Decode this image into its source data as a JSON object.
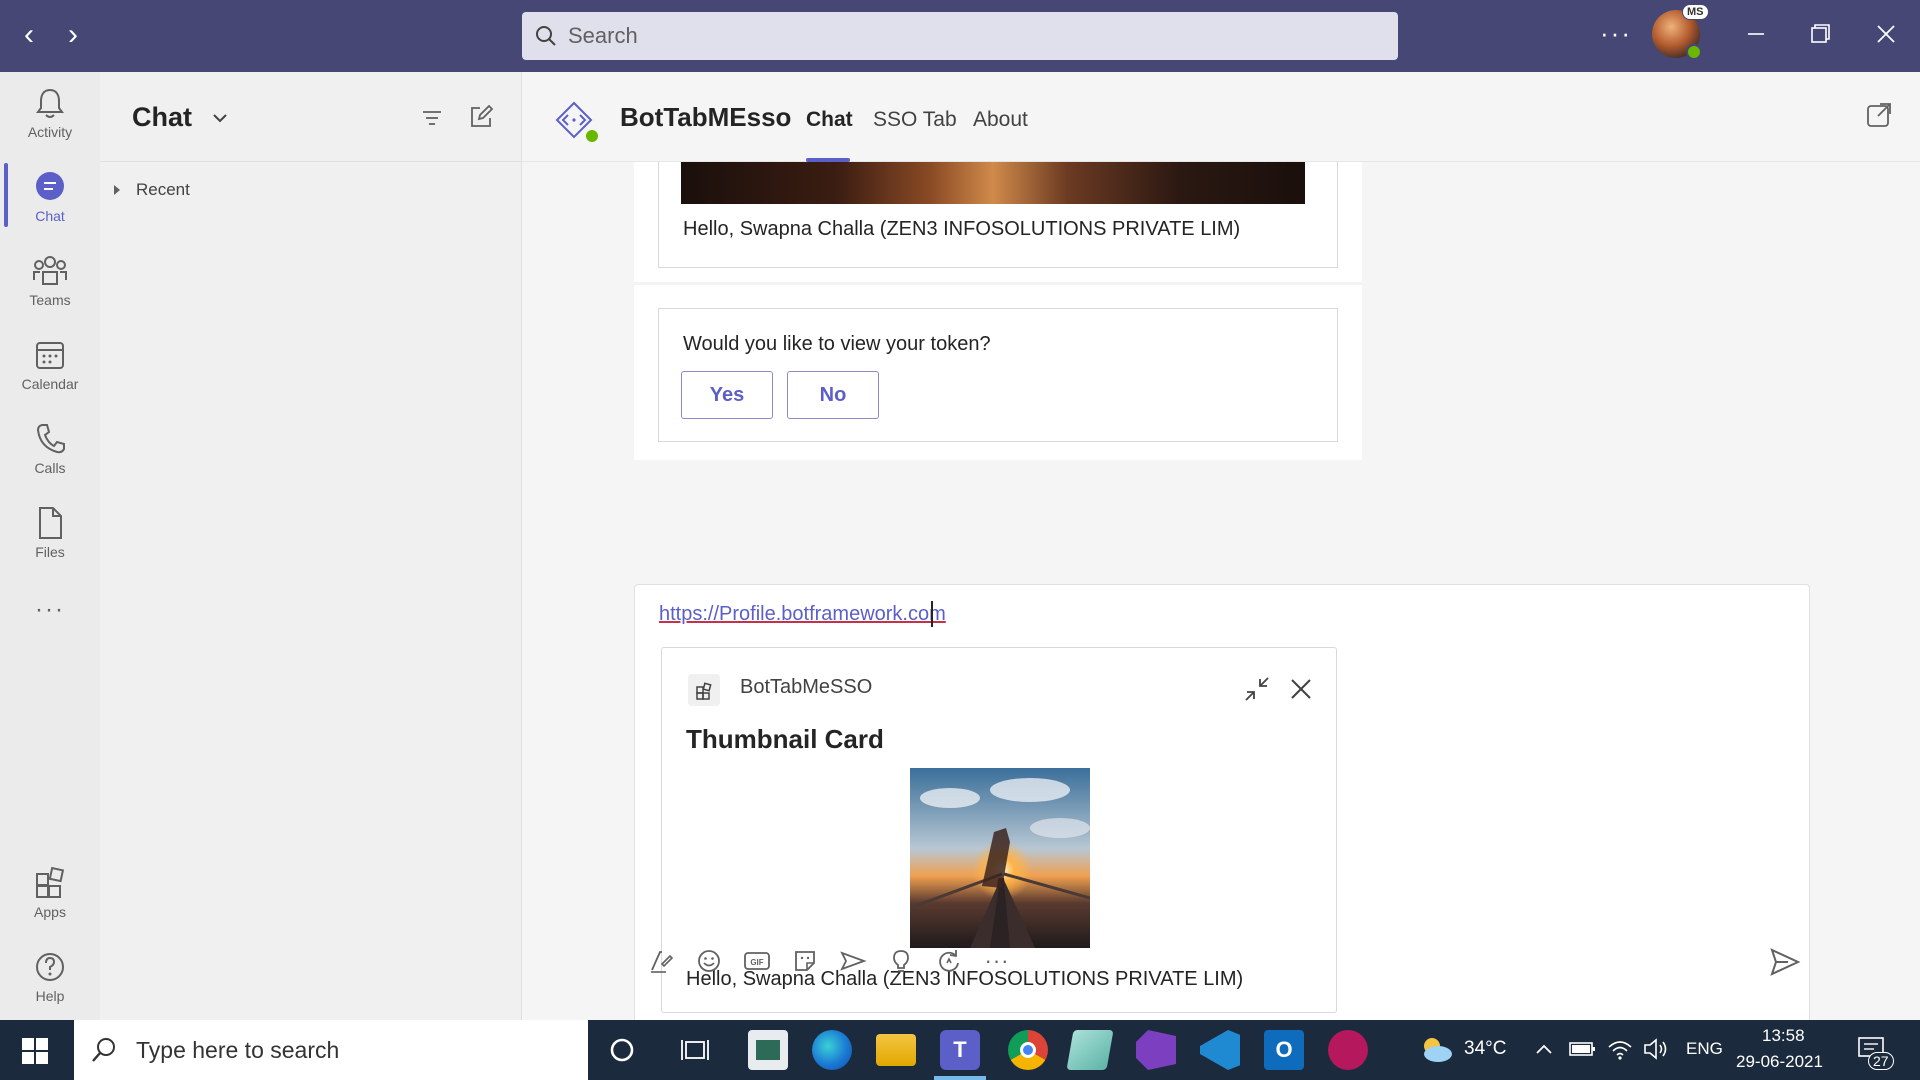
{
  "titlebar": {
    "search_placeholder": "Search",
    "more": "···",
    "avatar_initials": "MS"
  },
  "appbar": {
    "items": [
      {
        "label": "Activity",
        "icon": "bell-icon"
      },
      {
        "label": "Chat",
        "icon": "chat-icon"
      },
      {
        "label": "Teams",
        "icon": "teams-icon"
      },
      {
        "label": "Calendar",
        "icon": "calendar-icon"
      },
      {
        "label": "Calls",
        "icon": "phone-icon"
      },
      {
        "label": "Files",
        "icon": "file-icon"
      },
      {
        "label": "···",
        "icon": "more-icon"
      },
      {
        "label": "Apps",
        "icon": "apps-icon"
      },
      {
        "label": "Help",
        "icon": "help-icon"
      }
    ]
  },
  "chatlist": {
    "title": "Chat",
    "recent_label": "Recent"
  },
  "main": {
    "bot_name": "BotTabMEsso",
    "tabs": [
      {
        "label": "Chat",
        "active": true
      },
      {
        "label": "SSO Tab",
        "active": false
      },
      {
        "label": "About",
        "active": false
      }
    ]
  },
  "messages": {
    "card1_text": "Hello, Swapna Challa (ZEN3 INFOSOLUTIONS PRIVATE LIM)",
    "card2_question": "Would you like to view your token?",
    "card2_yes": "Yes",
    "card2_no": "No"
  },
  "compose": {
    "link_text": "https://Profile.botframework.com",
    "preview": {
      "app_name": "BotTabMeSSO",
      "title": "Thumbnail Card",
      "text": "Hello, Swapna Challa (ZEN3 INFOSOLUTIONS PRIVATE LIM)"
    },
    "tools": [
      "format-icon",
      "emoji-icon",
      "gif-icon",
      "sticker-icon",
      "meet-icon",
      "praise-icon",
      "loop-icon",
      "more-icon",
      "send-icon"
    ]
  },
  "taskbar": {
    "search_placeholder": "Type here to search",
    "temperature": "34°C",
    "language": "ENG",
    "time": "13:58",
    "date": "29-06-2021",
    "notification_count": "27"
  },
  "colors": {
    "titlebar": "#464775",
    "accent": "#5b5fc7",
    "taskbar": "#1b2a3d"
  }
}
